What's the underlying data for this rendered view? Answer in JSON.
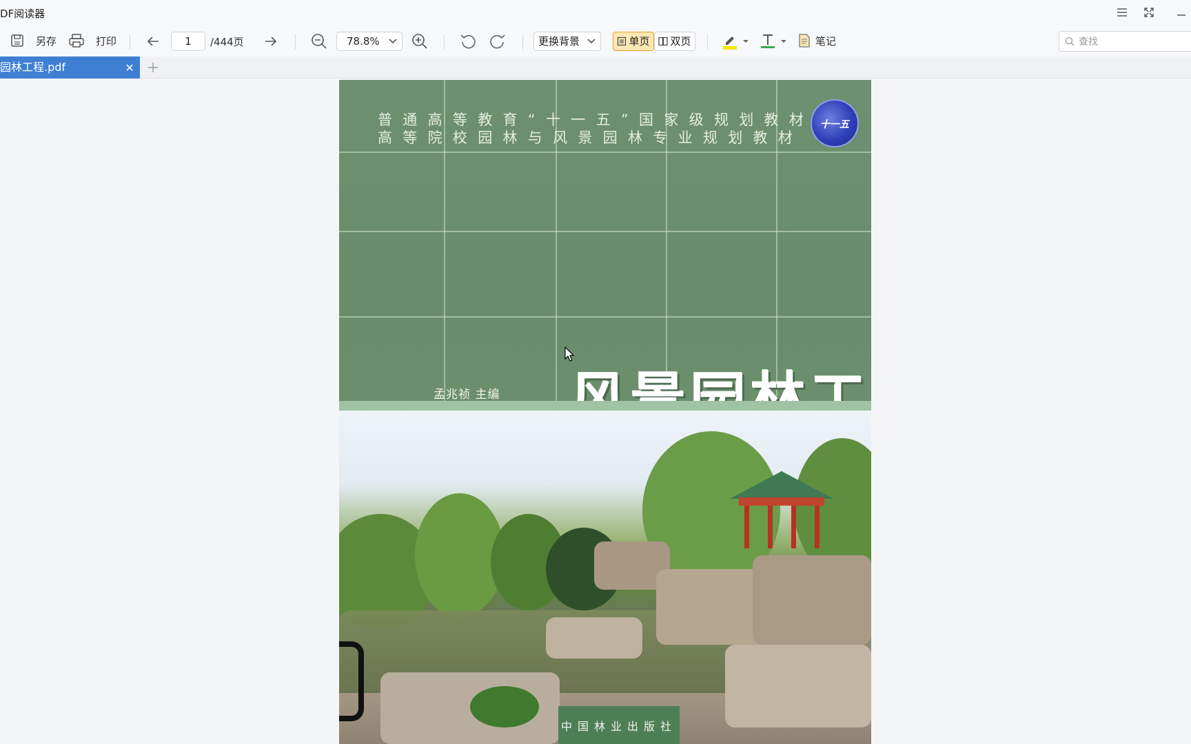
{
  "window": {
    "title": "DF阅读器"
  },
  "toolbar": {
    "save_as_label": "另存",
    "print_label": "打印",
    "page_current": "1",
    "page_total": "/444页",
    "zoom_value": "78.8%",
    "background_label": "更换背景",
    "single_page_label": "单页",
    "double_page_label": "双页",
    "notes_label": "笔记",
    "search_placeholder": "查找",
    "highlight_color": "#f5e600",
    "text_color": "#3aa655"
  },
  "tabs": [
    {
      "label": "园林工程.pdf",
      "active": true
    }
  ],
  "cover": {
    "series_line_1": "普通高等教育“十一五”国家级规划教材",
    "series_line_2": "高等院校园林与风景园林专业规划教材",
    "logo_text": "十一五",
    "author": "孟兆祯  主编",
    "title": "风景园林工程",
    "publisher": "中国林业出版社"
  }
}
